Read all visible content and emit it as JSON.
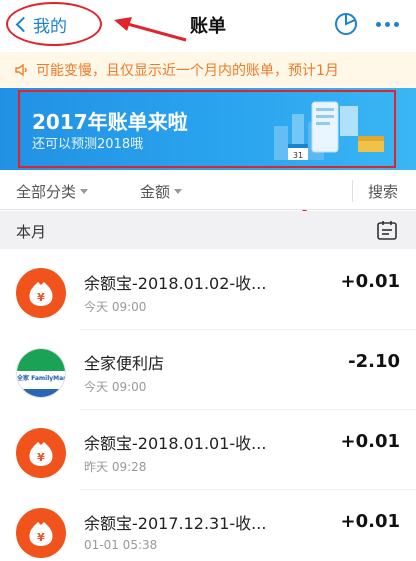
{
  "header": {
    "back_label": "我的",
    "title": "账单"
  },
  "notice": {
    "text": "可能变慢，且仅显示近一个月内的账单，预计1月"
  },
  "banner": {
    "title": "2017年账单来啦",
    "subtitle": "还可以预测2018哦",
    "calendar_number": "31"
  },
  "filters": {
    "category": "全部分类",
    "amount": "金额",
    "search": "搜索"
  },
  "month": {
    "label": "本月"
  },
  "transactions": [
    {
      "name": "余额宝-2018.01.02-收...",
      "time": "今天  09:00",
      "amount": "+0.01",
      "icon": "yuebao-icon"
    },
    {
      "name": "全家便利店",
      "time": "今天  09:00",
      "amount": "-2.10",
      "icon": "familymart-logo"
    },
    {
      "name": "余额宝-2018.01.01-收...",
      "time": "昨天  09:28",
      "amount": "+0.01",
      "icon": "yuebao-icon"
    },
    {
      "name": "余额宝-2017.12.31-收...",
      "time": "01-01  05:38",
      "amount": "+0.01",
      "icon": "yuebao-icon"
    }
  ],
  "familymart_text": "全家 FamilyMart",
  "colors": {
    "accent": "#1b82d1",
    "notice": "#ef7a26",
    "annotation": "#e3232b",
    "yuebao": "#f0541c"
  }
}
